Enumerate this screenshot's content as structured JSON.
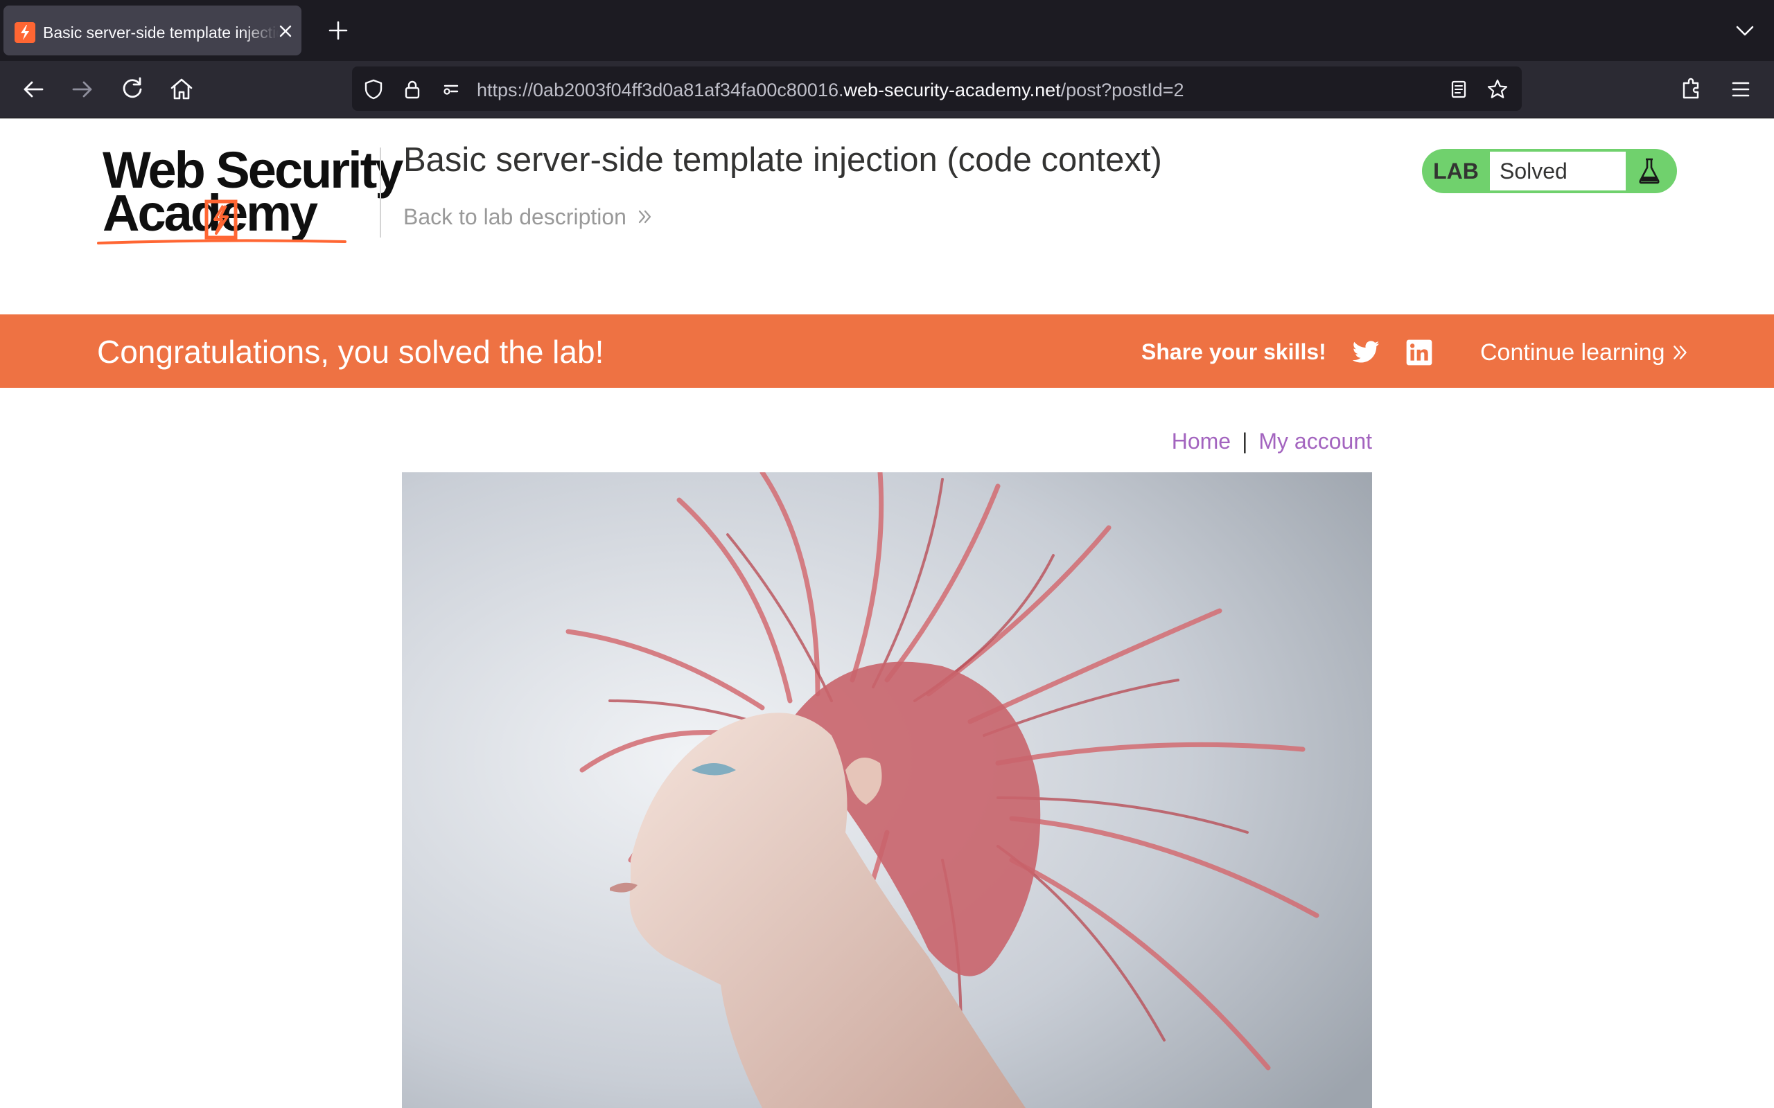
{
  "browser": {
    "tab": {
      "title": "Basic server-side template injection (code context)"
    },
    "url": {
      "prefix": "https://0ab2003f04ff3d0a81af34fa00c80016.",
      "host": "web-security-academy.net",
      "path": "/post?postId=2"
    }
  },
  "header": {
    "logo": {
      "line1": "Web Security",
      "line2": "Academy"
    },
    "lab_title": "Basic server-side template injection (code context)",
    "back_link": "Back to lab description",
    "lab_status": {
      "tag": "LAB",
      "state": "Solved"
    }
  },
  "banner": {
    "message": "Congratulations, you solved the lab!",
    "share_label": "Share your skills!",
    "continue_label": "Continue learning"
  },
  "nav": {
    "home": "Home",
    "separator": "|",
    "account": "My account"
  },
  "colors": {
    "accent": "#ee7243",
    "lab_solved": "#70d16d",
    "link": "#a364bf",
    "chrome_dark": "#1c1b22"
  },
  "icons": [
    "favicon-icon",
    "close-icon",
    "plus-icon",
    "chevron-down-icon",
    "back-arrow-icon",
    "forward-arrow-icon",
    "reload-icon",
    "home-icon",
    "shield-icon",
    "lock-icon",
    "permissions-icon",
    "reader-view-icon",
    "star-icon",
    "extensions-icon",
    "hamburger-menu-icon",
    "flask-icon",
    "twitter-icon",
    "linkedin-icon",
    "double-chevron-icon"
  ]
}
